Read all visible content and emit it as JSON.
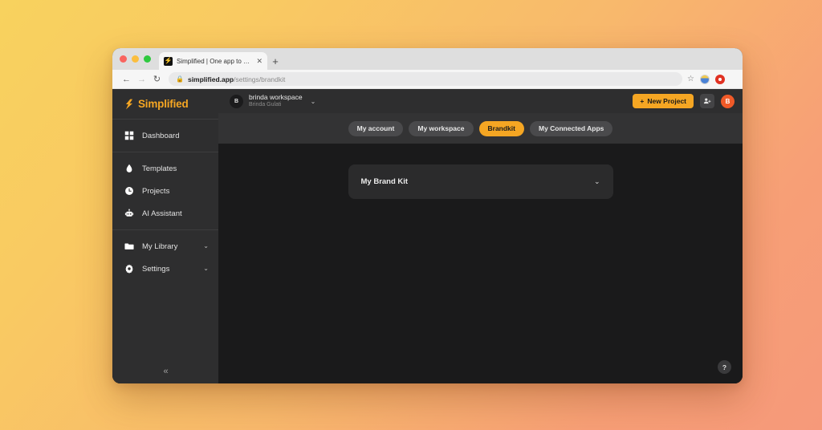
{
  "browser": {
    "tab": {
      "title": "Simplified | One app to design",
      "close_label": "✕",
      "favicon_name": "simplified-favicon"
    },
    "new_tab_label": "+",
    "nav": {
      "back": "←",
      "forward": "→",
      "reload": "↻"
    },
    "omnibox": {
      "lock": "🔒",
      "url_domain": "simplified.app",
      "url_path": "/settings/brandkit",
      "star": "☆"
    }
  },
  "sidebar": {
    "brand_name": "Simplified",
    "groups": [
      {
        "items": [
          {
            "label": "Dashboard",
            "icon": "dashboard-grid-icon",
            "caret": ""
          }
        ]
      },
      {
        "items": [
          {
            "label": "Templates",
            "icon": "droplet-icon",
            "caret": ""
          },
          {
            "label": "Projects",
            "icon": "clock-icon",
            "caret": ""
          },
          {
            "label": "AI Assistant",
            "icon": "robot-icon",
            "caret": ""
          }
        ]
      },
      {
        "items": [
          {
            "label": "My Library",
            "icon": "folder-icon",
            "caret": "⌄"
          },
          {
            "label": "Settings",
            "icon": "gear-icon",
            "caret": "⌄"
          }
        ]
      }
    ],
    "collapse_label": "«"
  },
  "topbar": {
    "workspace_initial": "B",
    "workspace_name": "brinda workspace",
    "workspace_user": "Brinda Gulati",
    "workspace_caret": "⌄",
    "new_project_label": "New Project",
    "new_project_plus": "+",
    "invite_icon": "add-person-icon",
    "user_initial": "B"
  },
  "tabs": [
    {
      "label": "My account",
      "active": false
    },
    {
      "label": "My workspace",
      "active": false
    },
    {
      "label": "Brandkit",
      "active": true
    },
    {
      "label": "My Connected Apps",
      "active": false
    }
  ],
  "content": {
    "brandkit_card_title": "My Brand Kit",
    "brandkit_card_caret": "⌄",
    "help_label": "?"
  },
  "colors": {
    "accent": "#f5a623",
    "sidebar_bg": "#2e2e2f",
    "content_bg": "#1a1a1b",
    "tabs_bg": "#333334",
    "card_bg": "#2b2b2c",
    "avatar_orange": "#f05a28",
    "bg_gradient_start": "#f8d25e",
    "bg_gradient_end": "#f6997a"
  }
}
